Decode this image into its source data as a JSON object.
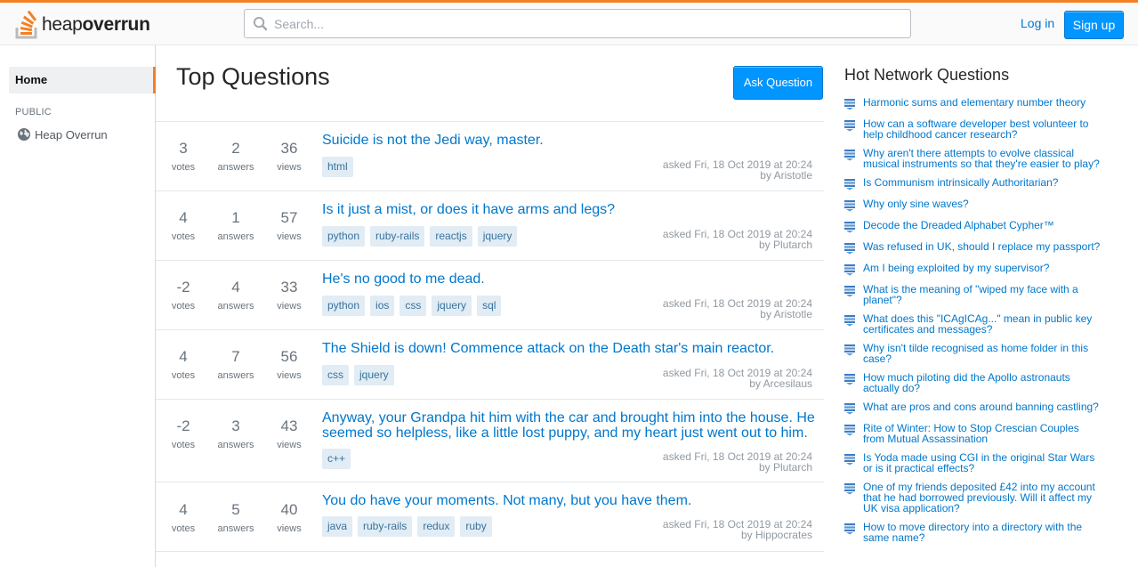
{
  "header": {
    "logo_text_light": "heap",
    "logo_text_bold": "overrun",
    "search_placeholder": "Search...",
    "login_label": "Log in",
    "signup_label": "Sign up"
  },
  "sidebar": {
    "home_label": "Home",
    "section_label": "PUBLIC",
    "heap_label": "Heap Overrun"
  },
  "main": {
    "title": "Top Questions",
    "ask_button": "Ask Question",
    "questions": [
      {
        "votes": "3",
        "votes_label": "votes",
        "answers": "2",
        "answers_label": "answers",
        "views": "36",
        "views_label": "views",
        "title": "Suicide is not the Jedi way, master.",
        "tags": [
          "html"
        ],
        "asked": "asked Fri, 18 Oct 2019 at 20:24",
        "by": "by Aristotle"
      },
      {
        "votes": "4",
        "votes_label": "votes",
        "answers": "1",
        "answers_label": "answers",
        "views": "57",
        "views_label": "views",
        "title": "Is it just a mist, or does it have arms and legs?",
        "tags": [
          "python",
          "ruby-rails",
          "reactjs",
          "jquery"
        ],
        "asked": "asked Fri, 18 Oct 2019 at 20:24",
        "by": "by Plutarch"
      },
      {
        "votes": "-2",
        "votes_label": "votes",
        "answers": "4",
        "answers_label": "answers",
        "views": "33",
        "views_label": "views",
        "title": "He's no good to me dead.",
        "tags": [
          "python",
          "ios",
          "css",
          "jquery",
          "sql"
        ],
        "asked": "asked Fri, 18 Oct 2019 at 20:24",
        "by": "by Aristotle"
      },
      {
        "votes": "4",
        "votes_label": "votes",
        "answers": "7",
        "answers_label": "answers",
        "views": "56",
        "views_label": "views",
        "title": "The Shield is down! Commence attack on the Death star's main reactor.",
        "tags": [
          "css",
          "jquery"
        ],
        "asked": "asked Fri, 18 Oct 2019 at 20:24",
        "by": "by Arcesilaus"
      },
      {
        "votes": "-2",
        "votes_label": "votes",
        "answers": "3",
        "answers_label": "answers",
        "views": "43",
        "views_label": "views",
        "title": "Anyway, your Grandpa hit him with the car and brought him into the house. He seemed so helpless, like a little lost puppy, and my heart just went out to him.",
        "tags": [
          "c++"
        ],
        "asked": "asked Fri, 18 Oct 2019 at 20:24",
        "by": "by Plutarch"
      },
      {
        "votes": "4",
        "votes_label": "votes",
        "answers": "5",
        "answers_label": "answers",
        "views": "40",
        "views_label": "views",
        "title": "You do have your moments. Not many, but you have them.",
        "tags": [
          "java",
          "ruby-rails",
          "redux",
          "ruby"
        ],
        "asked": "asked Fri, 18 Oct 2019 at 20:24",
        "by": "by Hippocrates"
      }
    ]
  },
  "hot_network": {
    "title": "Hot Network Questions",
    "items": [
      "Harmonic sums and elementary number theory",
      "How can a software developer best volunteer to help childhood cancer research?",
      "Why aren't there attempts to evolve classical musical instruments so that they're easier to play?",
      "Is Communism intrinsically Authoritarian?",
      "Why only sine waves?",
      "Decode the Dreaded Alphabet Cypher™",
      "Was refused in UK, should I replace my passport?",
      "Am I being exploited by my supervisor?",
      "What is the meaning of \"wiped my face with a planet\"?",
      "What does this \"ICAgICAg...\" mean in public key certificates and messages?",
      "Why isn't tilde recognised as home folder in this case?",
      "How much piloting did the Apollo astronauts actually do?",
      "What are pros and cons around banning castling?",
      "Rite of Winter: How to Stop Crescian Couples from Mutual Assassination",
      "Is Yoda made using CGI in the original Star Wars or is it practical effects?",
      "One of my friends deposited £42 into my account that he had borrowed previously. Will it affect my UK visa application?",
      "How to move directory into a directory with the same name?"
    ]
  },
  "colors": {
    "accent": "#f48024",
    "link": "#0077cc",
    "button": "#0095ff",
    "tag_bg": "#e1ecf4",
    "tag_text": "#39739d"
  },
  "icons": {
    "logo": "stack-logo-icon",
    "search": "search-icon",
    "globe": "globe-icon",
    "site": "site-stack-icon"
  }
}
